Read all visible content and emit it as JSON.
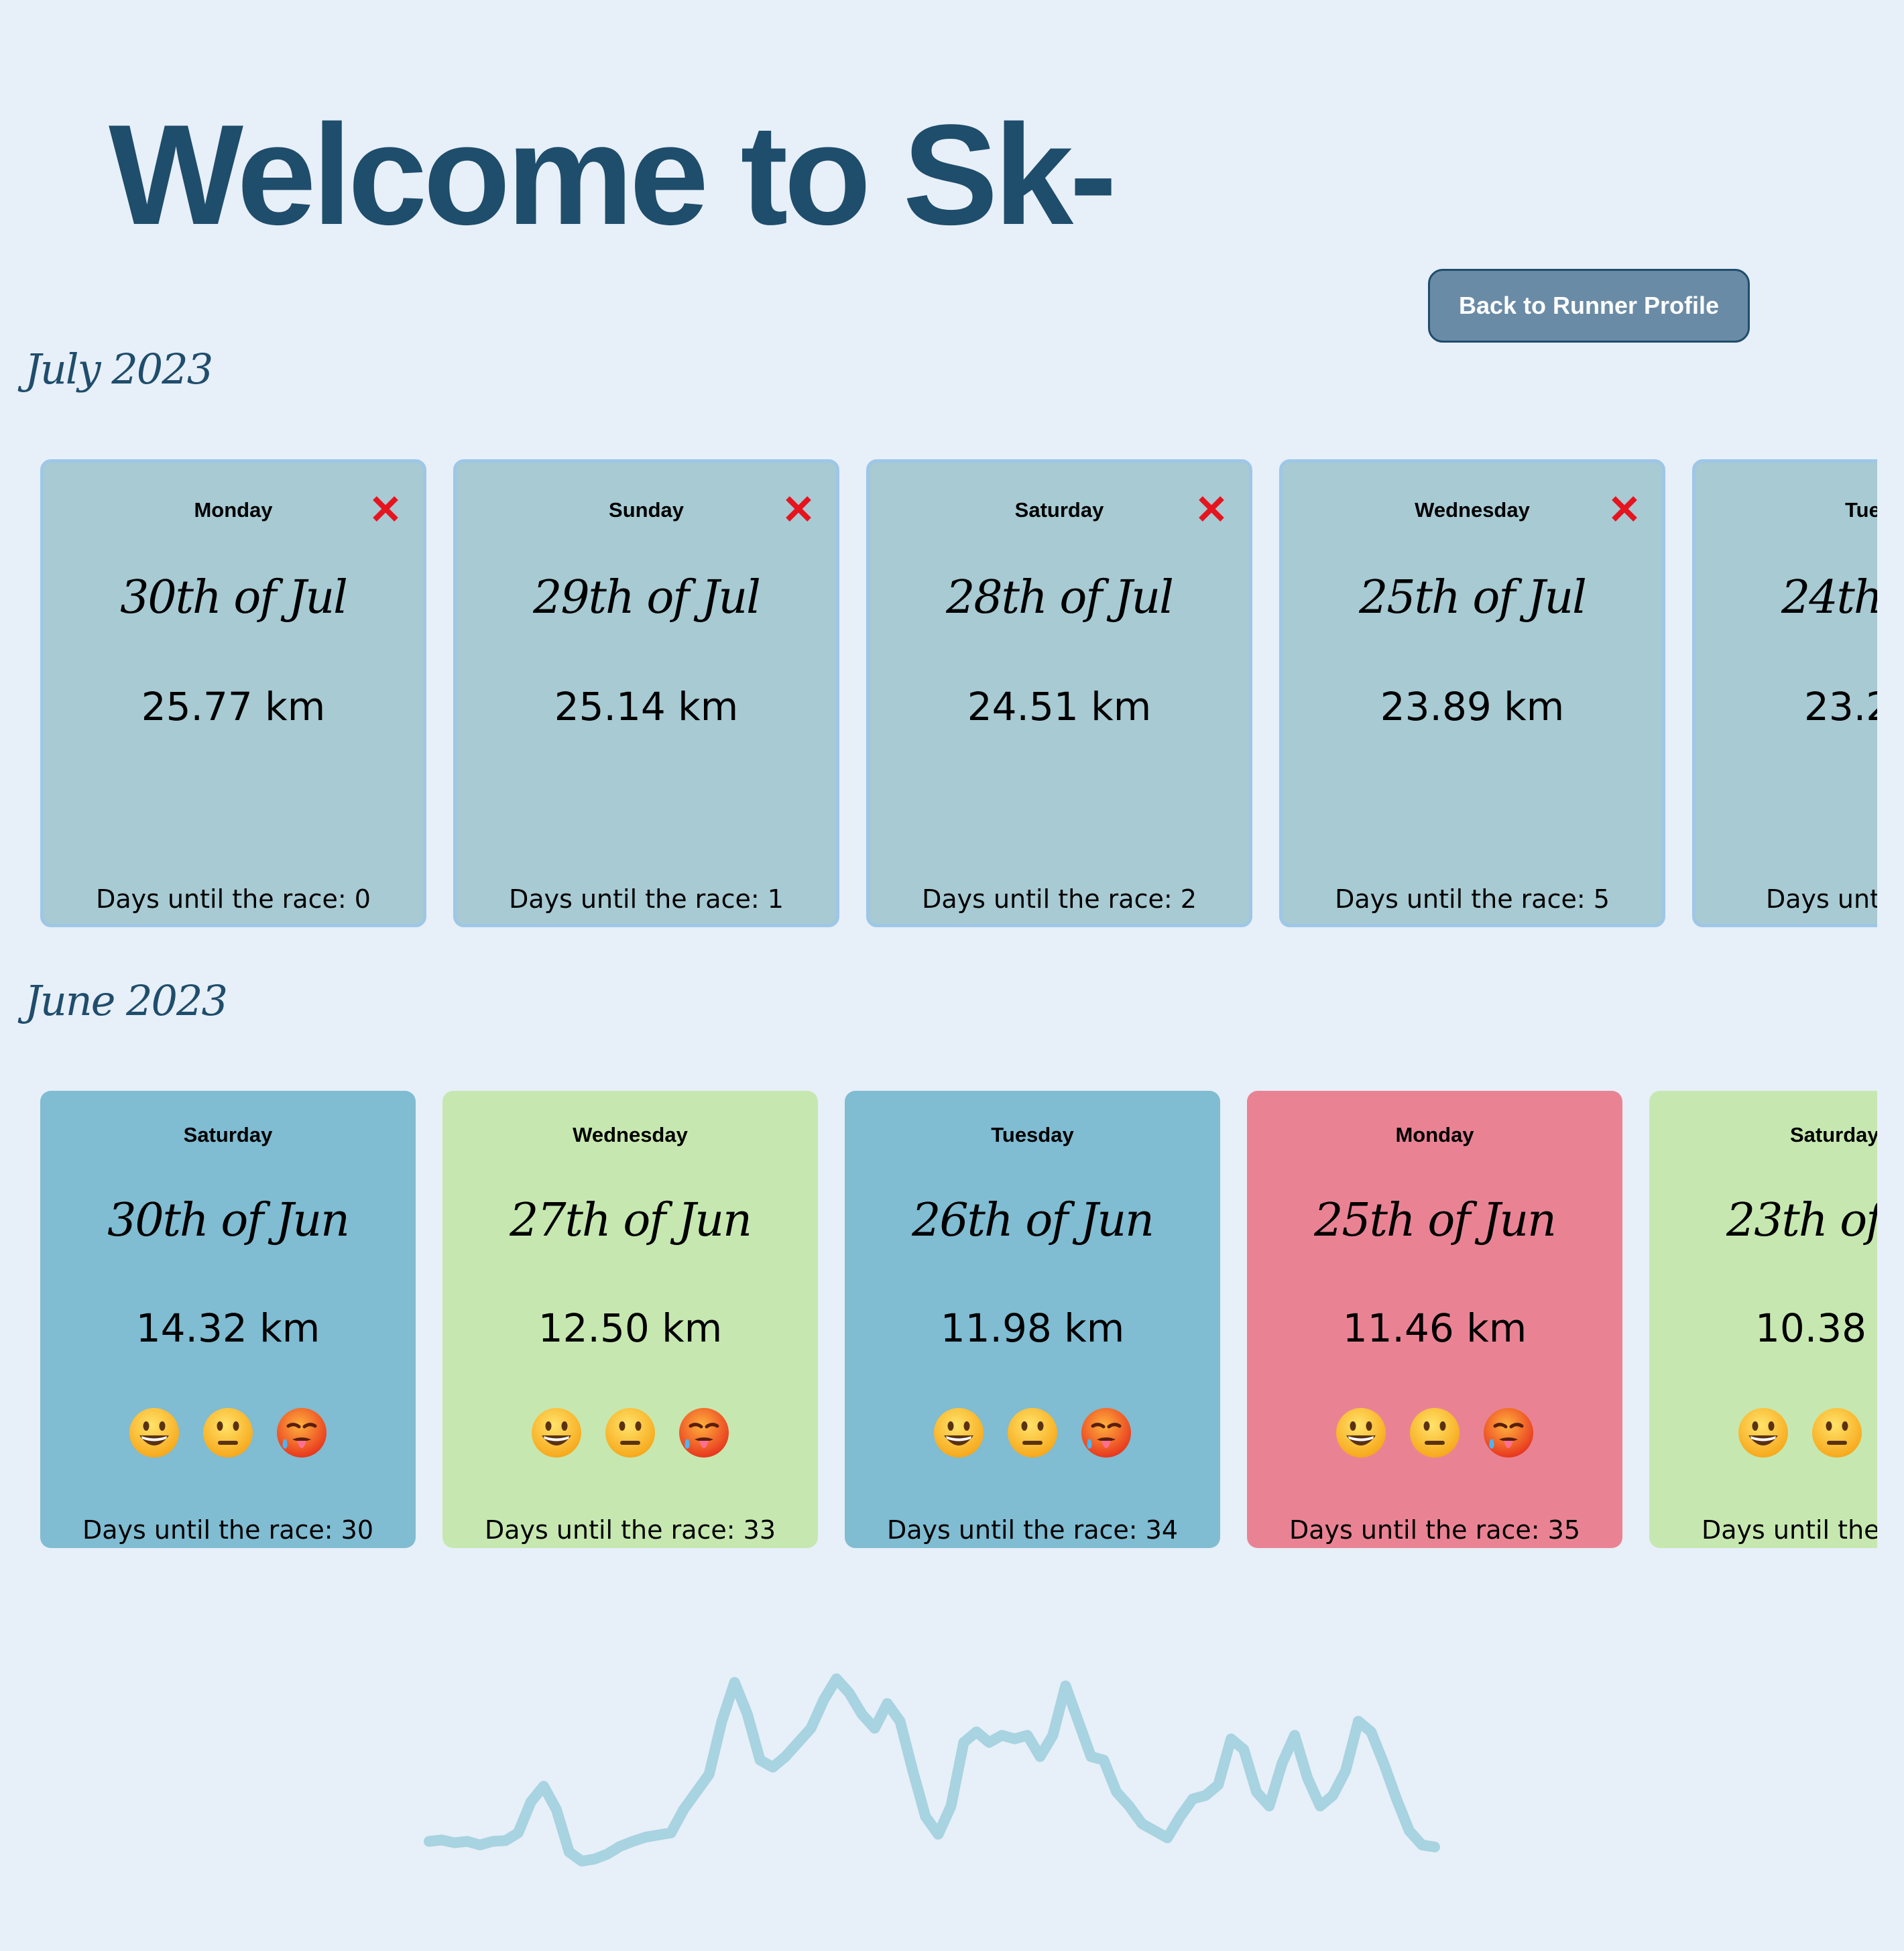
{
  "page": {
    "title": "Welcome to Sk-",
    "back_button_label": "Back to Runner Profile"
  },
  "months": [
    {
      "heading": "July 2023",
      "style": "uniform",
      "card_color": "#a7cad3",
      "runs": [
        {
          "weekday": "Monday",
          "date": "30th of Jul",
          "distance": "25.77 km",
          "countdown": "Days until the race: 0"
        },
        {
          "weekday": "Sunday",
          "date": "29th of Jul",
          "distance": "25.14 km",
          "countdown": "Days until the race: 1"
        },
        {
          "weekday": "Saturday",
          "date": "28th of Jul",
          "distance": "24.51 km",
          "countdown": "Days until the race: 2"
        },
        {
          "weekday": "Wednesday",
          "date": "25th of Jul",
          "distance": "23.89 km",
          "countdown": "Days until the race: 5"
        },
        {
          "weekday": "Tue",
          "date": "24th",
          "distance": "23.2",
          "countdown": "Days unti"
        }
      ]
    },
    {
      "heading": "June 2023",
      "style": "mood",
      "mood_colors": {
        "good": "#c6e8b0",
        "neutral": "#80bcd2",
        "bad": "#e98394"
      },
      "runs": [
        {
          "weekday": "Saturday",
          "date": "30th of Jun",
          "distance": "14.32 km",
          "countdown": "Days until the race: 30",
          "color": "#80bcd2"
        },
        {
          "weekday": "Wednesday",
          "date": "27th of Jun",
          "distance": "12.50 km",
          "countdown": "Days until the race: 33",
          "color": "#c6e8b0"
        },
        {
          "weekday": "Tuesday",
          "date": "26th of Jun",
          "distance": "11.98 km",
          "countdown": "Days until the race: 34",
          "color": "#80bcd2"
        },
        {
          "weekday": "Monday",
          "date": "25th of Jun",
          "distance": "11.46 km",
          "countdown": "Days until the race: 35",
          "color": "#e98394"
        },
        {
          "weekday": "Saturday",
          "date": "23th of J",
          "distance": "10.38 k",
          "countdown": "Days until the r",
          "color": "#c6e8b0"
        }
      ]
    }
  ],
  "icons": {
    "delete": "close-x-icon",
    "feelings": [
      "grinning-face-icon",
      "neutral-face-icon",
      "hot-face-icon"
    ]
  },
  "colors": {
    "background": "#e7eff8",
    "title": "#1f4d6c",
    "button": "#6a8ba6",
    "delete": "#e5141e",
    "sparkline": "#a8d3e0"
  },
  "sparkline": {
    "values": [
      3.0,
      3.2,
      2.8,
      3.0,
      2.5,
      3.0,
      3.1,
      4.2,
      8.6,
      10.8,
      7.5,
      1.5,
      0.2,
      0.5,
      1.2,
      2.3,
      3.0,
      3.6,
      3.9,
      4.2,
      7.5,
      10.0,
      12.5,
      20.0,
      25.5,
      21.0,
      14.5,
      13.5,
      15.0,
      17.0,
      19.0,
      23.0,
      26.0,
      24.0,
      21.0,
      19.0,
      22.5,
      20.0,
      13.0,
      6.5,
      4.0,
      8.0,
      17.0,
      18.5,
      17.0,
      18.0,
      17.5,
      18.0,
      15.0,
      18.0,
      25.0,
      20.0,
      15.0,
      14.5,
      10.0,
      8.0,
      5.5,
      4.5,
      3.5,
      6.5,
      9.0,
      9.5,
      11.0,
      17.5,
      16.0,
      10.0,
      8.0,
      14.0,
      18.0,
      12.0,
      8.0,
      9.5,
      13.0,
      20.0,
      18.5,
      14.0,
      9.0,
      4.5,
      2.5,
      2.2
    ]
  }
}
